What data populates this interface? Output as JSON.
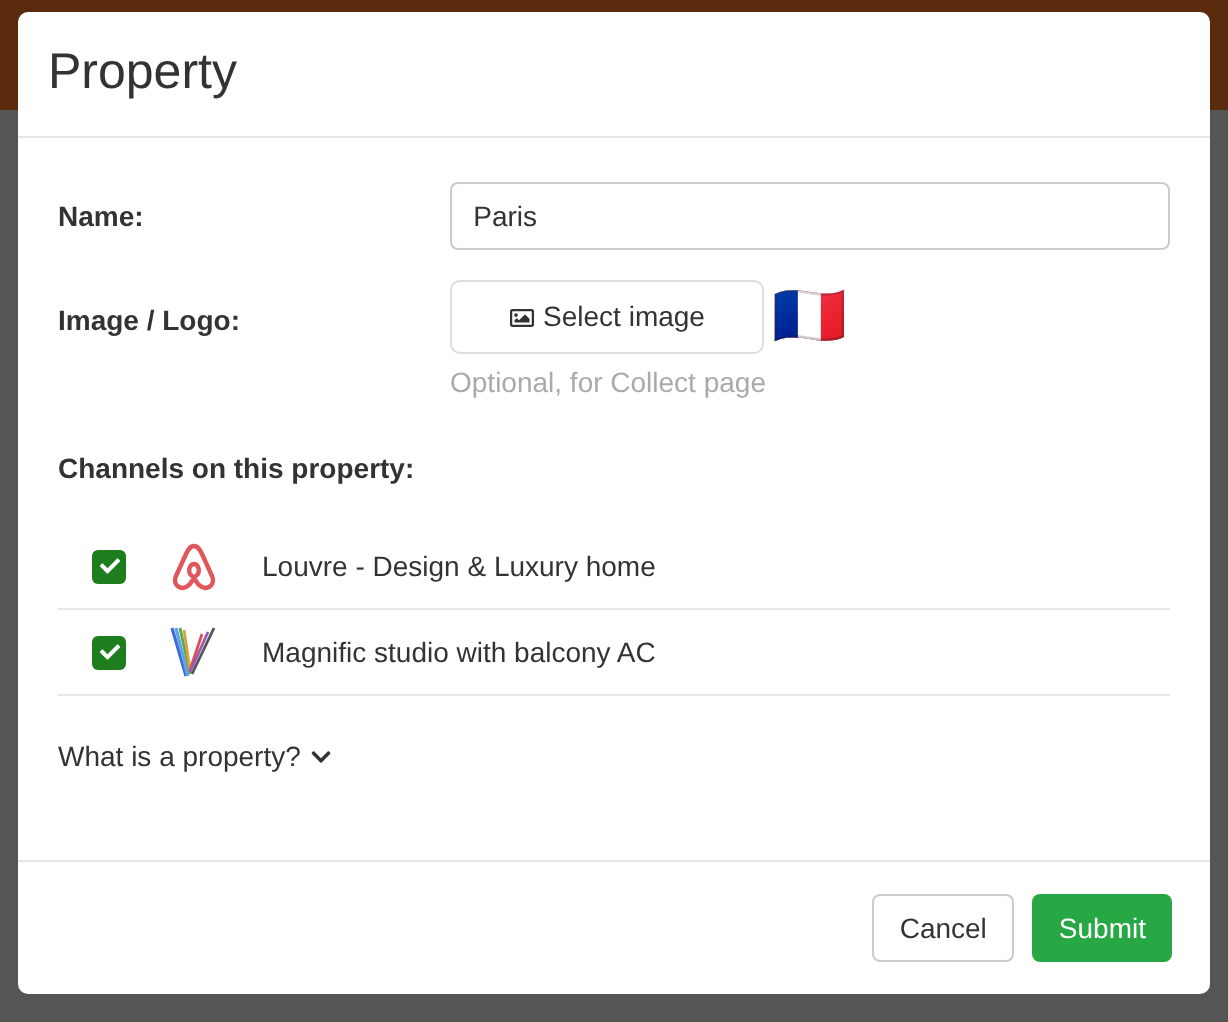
{
  "dialog": {
    "title": "Property"
  },
  "form": {
    "name_label": "Name:",
    "name_value": "Paris",
    "image_label": "Image / Logo:",
    "select_button": "Select image",
    "hint": "Optional, for Collect page",
    "flag": "🇫🇷"
  },
  "channels_heading": "Channels on this property:",
  "channels": [
    {
      "name": "Louvre - Design & Luxury home",
      "checked": true,
      "kind": "loop"
    },
    {
      "name": "Magnific studio with balcony AC",
      "checked": true,
      "kind": "stripes"
    }
  ],
  "help_link": "What is a property?",
  "buttons": {
    "cancel": "Cancel",
    "submit": "Submit"
  }
}
